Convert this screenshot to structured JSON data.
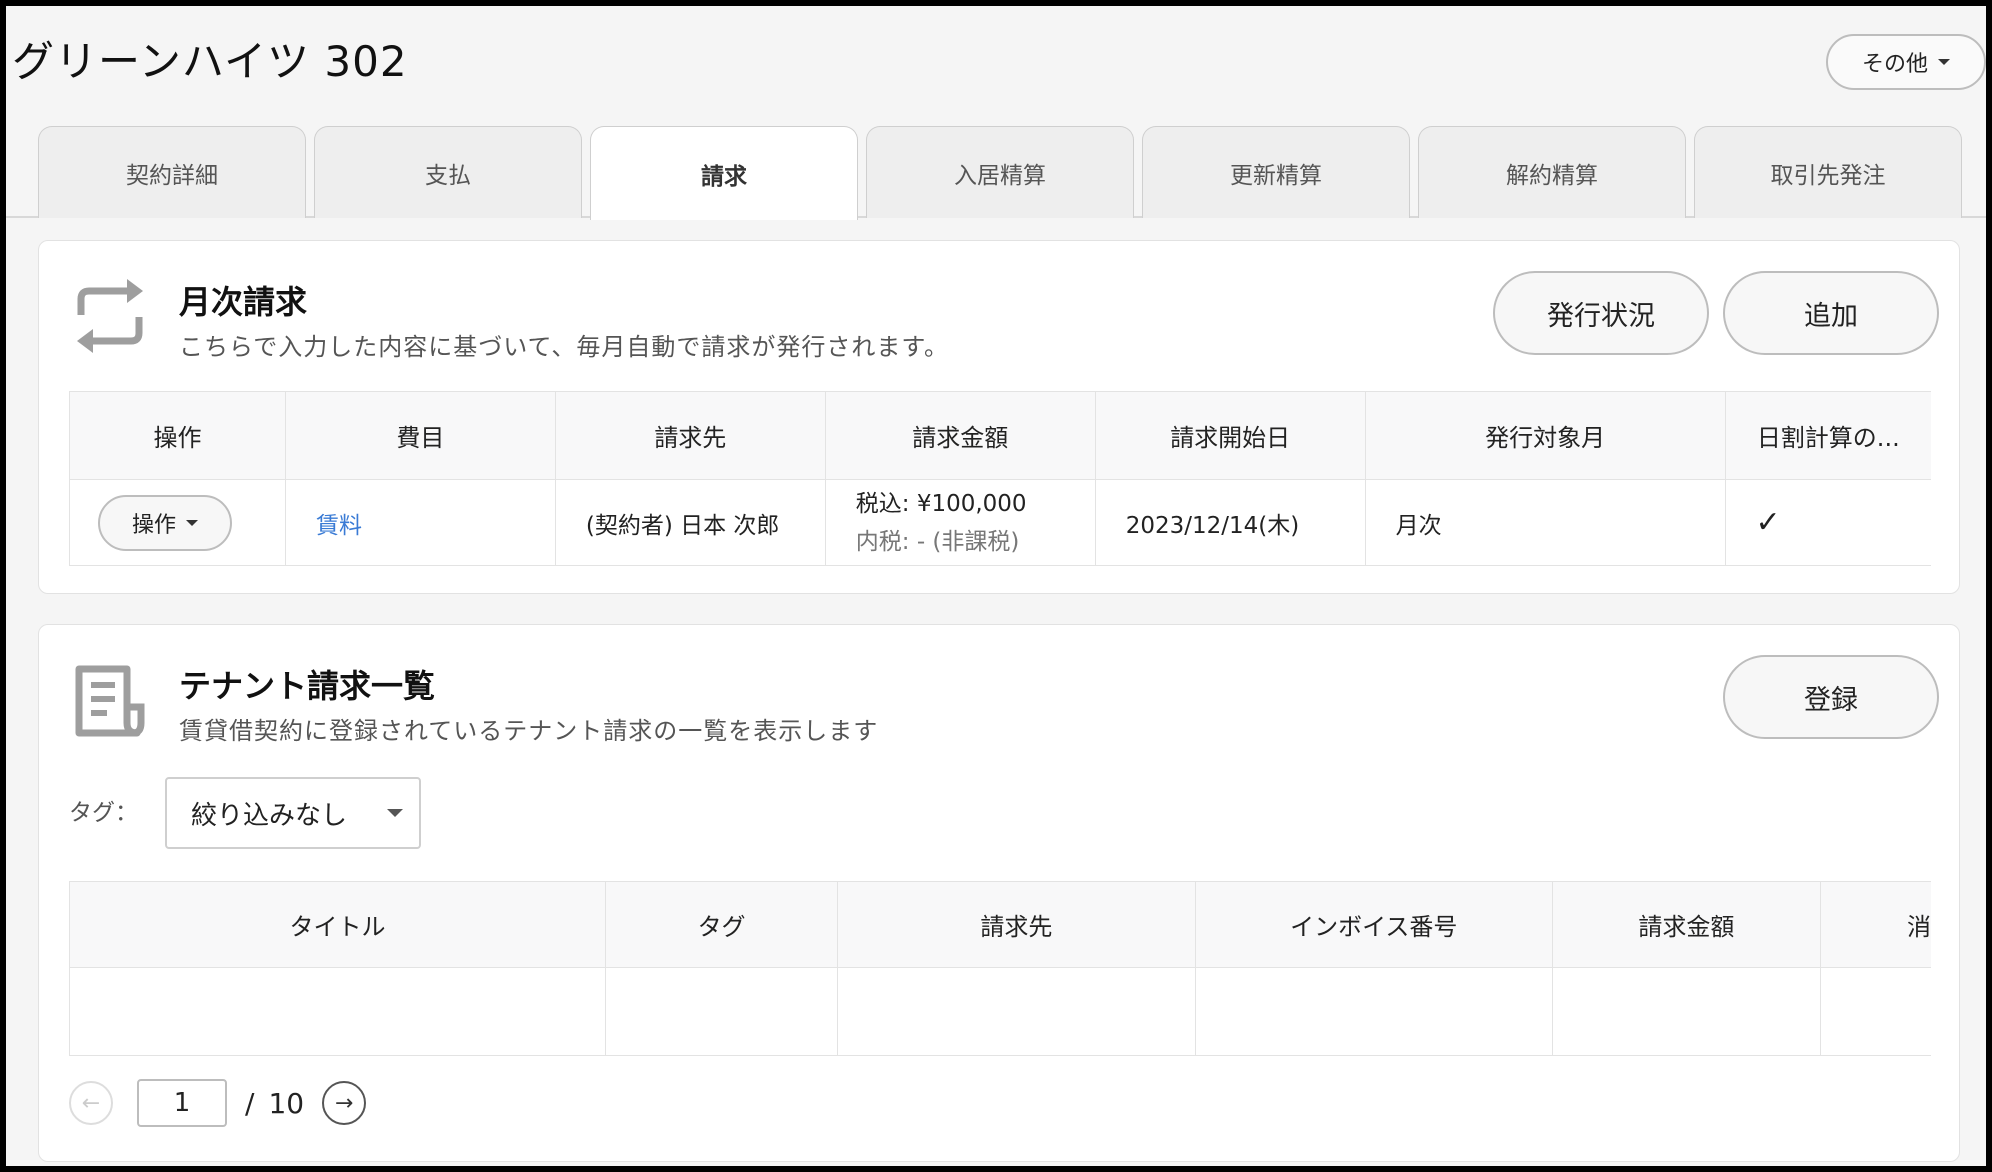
{
  "header": {
    "title": "グリーンハイツ 302",
    "other_button": "その他"
  },
  "tabs": [
    {
      "label": "契約詳細",
      "active": false
    },
    {
      "label": "支払",
      "active": false
    },
    {
      "label": "請求",
      "active": true
    },
    {
      "label": "入居精算",
      "active": false
    },
    {
      "label": "更新精算",
      "active": false
    },
    {
      "label": "解約精算",
      "active": false
    },
    {
      "label": "取引先発注",
      "active": false
    }
  ],
  "monthly": {
    "title": "月次請求",
    "subtitle": "こちらで入力した内容に基づいて、毎月自動で請求が発行されます。",
    "status_button": "発行状況",
    "add_button": "追加",
    "columns": [
      "操作",
      "費目",
      "請求先",
      "請求金額",
      "請求開始日",
      "発行対象月",
      "日割計算の..."
    ],
    "rows": [
      {
        "action": "操作",
        "item": "賃料",
        "billing_to": "(契約者) 日本 次郎",
        "amount_incl": "税込: ¥100,000",
        "amount_tax": "内税: - (非課税)",
        "start_date": "2023/12/14(木)",
        "target_month": "月次",
        "prorated": "✓"
      }
    ]
  },
  "tenant": {
    "title": "テナント請求一覧",
    "subtitle": "賃貸借契約に登録されているテナント請求の一覧を表示します",
    "register_button": "登録",
    "tag_label": "タグ：",
    "tag_value": "絞り込みなし",
    "columns": [
      "タイトル",
      "タグ",
      "請求先",
      "インボイス番号",
      "請求金額",
      "消"
    ]
  },
  "pager": {
    "current": "1",
    "slash": "/",
    "total": "10",
    "prev": "←",
    "next": "→"
  }
}
